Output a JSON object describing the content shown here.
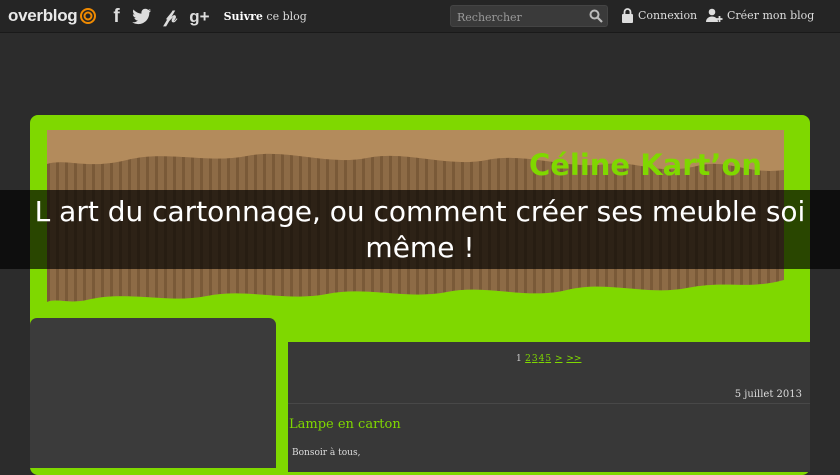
{
  "topbar": {
    "logo": "overblog",
    "follow_bold": "Suivre",
    "follow_rest": " ce blog",
    "search_placeholder": "Rechercher",
    "login": "Connexion",
    "create_blog": "Créer mon blog",
    "social_icons": [
      "facebook-icon",
      "twitter-icon",
      "pinterest-icon",
      "google-plus-icon"
    ]
  },
  "banner": {
    "blog_title": "Céline Kart’on"
  },
  "overlay": {
    "title": "L art du cartonnage, ou comment créer ses meuble soi même !"
  },
  "pager": {
    "current": "1",
    "pages": [
      "2",
      "3",
      "4",
      "5"
    ],
    "next": ">",
    "last": ">>"
  },
  "post": {
    "date": "5 juillet 2013",
    "title": "Lampe en carton",
    "excerpt": "Bonsoir à tous,"
  },
  "colors": {
    "accent": "#7fd800",
    "background": "#2c2c2c",
    "topbar": "#252525"
  }
}
